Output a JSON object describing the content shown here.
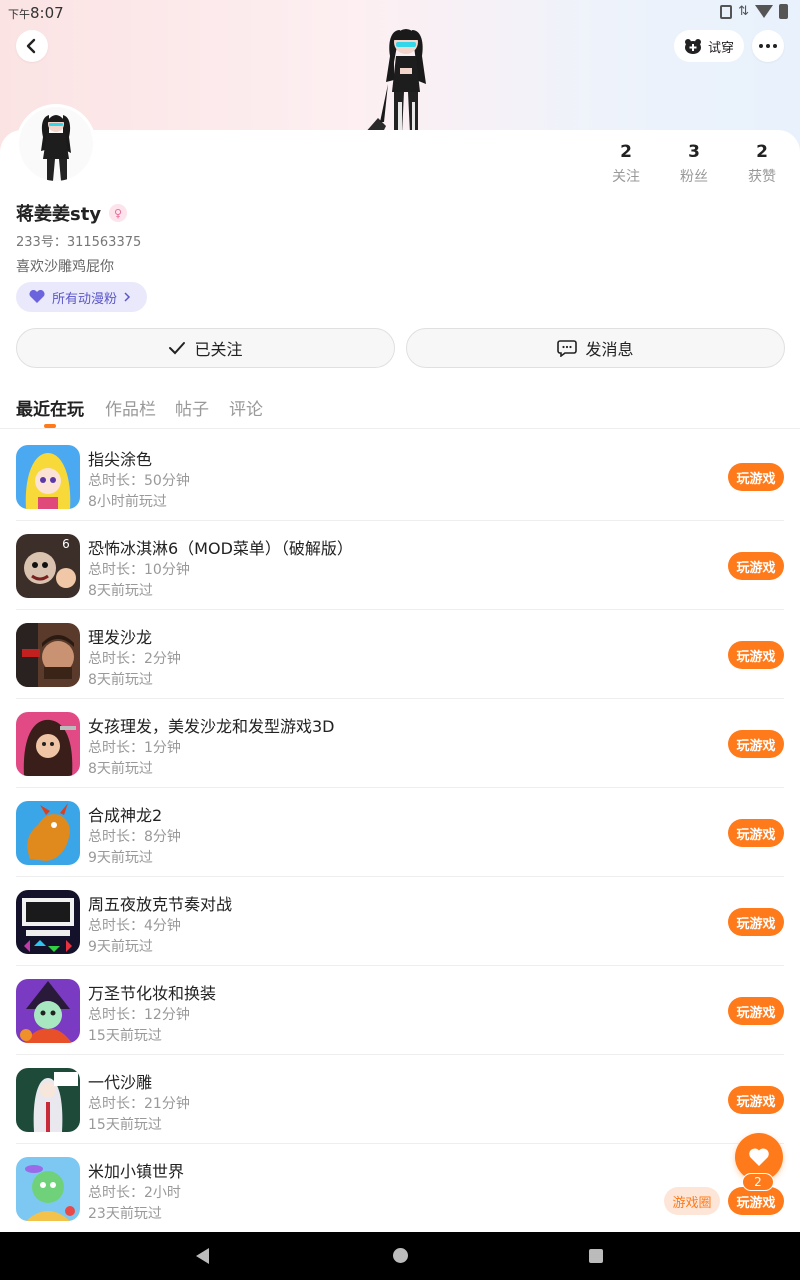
{
  "status_bar": {
    "period": "下午",
    "time": "8:07"
  },
  "header": {
    "try_on_label": "试穿"
  },
  "profile": {
    "name": "蒋姜姜sty",
    "uid": "233号：311563375",
    "bio": "喜欢沙雕鸡屁你",
    "fan_tag": "所有动漫粉",
    "gender_icon": "female-icon"
  },
  "stats": [
    {
      "value": "2",
      "label": "关注"
    },
    {
      "value": "3",
      "label": "粉丝"
    },
    {
      "value": "2",
      "label": "获赞"
    }
  ],
  "actions": {
    "follow_label": "已关注",
    "message_label": "发消息"
  },
  "tabs": [
    {
      "label": "最近在玩",
      "active": true
    },
    {
      "label": "作品栏",
      "active": false
    },
    {
      "label": "帖子",
      "active": false
    },
    {
      "label": "评论",
      "active": false
    }
  ],
  "games": [
    {
      "name": "指尖涂色",
      "duration": "总时长：50分钟",
      "last_played": "8小时前玩过",
      "button": "玩游戏"
    },
    {
      "name": "恐怖冰淇淋6（MOD菜单）（破解版）",
      "duration": "总时长：10分钟",
      "last_played": "8天前玩过",
      "button": "玩游戏"
    },
    {
      "name": "理发沙龙",
      "duration": "总时长：2分钟",
      "last_played": "8天前玩过",
      "button": "玩游戏"
    },
    {
      "name": "女孩理发，美发沙龙和发型游戏3D",
      "duration": "总时长：1分钟",
      "last_played": "8天前玩过",
      "button": "玩游戏"
    },
    {
      "name": "合成神龙2",
      "duration": "总时长：8分钟",
      "last_played": "9天前玩过",
      "button": "玩游戏"
    },
    {
      "name": "周五夜放克节奏对战",
      "duration": "总时长：4分钟",
      "last_played": "9天前玩过",
      "button": "玩游戏"
    },
    {
      "name": "万圣节化妆和换装",
      "duration": "总时长：12分钟",
      "last_played": "15天前玩过",
      "button": "玩游戏"
    },
    {
      "name": "一代沙雕",
      "duration": "总时长：21分钟",
      "last_played": "15天前玩过",
      "button": "玩游戏"
    },
    {
      "name": "米加小镇世界",
      "duration": "总时长：2小时",
      "last_played": "23天前玩过",
      "button": "玩游戏",
      "extra_button": "游戏圈"
    }
  ],
  "fab": {
    "count": "2"
  },
  "colors": {
    "accent": "#ff7a1a",
    "fan_tag_bg": "#e9e9fb",
    "fan_tag_text": "#5b56c9"
  }
}
